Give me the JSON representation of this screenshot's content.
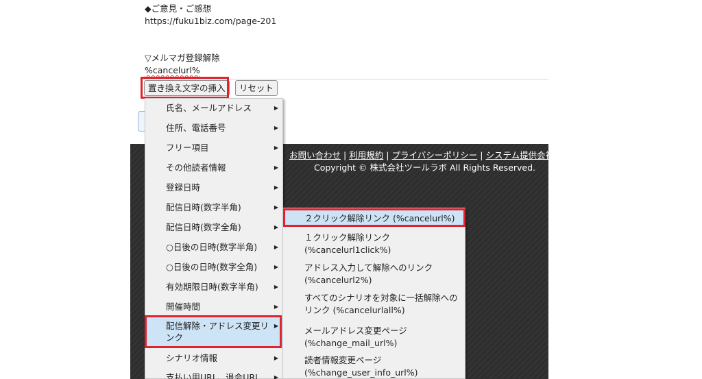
{
  "editor": {
    "line1": "◆ご意見・ご感想",
    "line2": "https://fuku1biz.com/page-201",
    "line3": "▽メルマガ登録解除",
    "line4": "%cancelurl%"
  },
  "buttons": {
    "insert_label": "置き換え文字の挿入",
    "reset_label": "リセット"
  },
  "footer": {
    "links": [
      "お問い合わせ",
      "利用規約",
      "プライバシーポリシー",
      "システム提供会社"
    ],
    "separator": "|",
    "copyright": "Copyright © 株式会社ツールラボ All Rights Reserved."
  },
  "menu1": {
    "items": [
      {
        "label": "氏名、メールアドレス"
      },
      {
        "label": "住所、電話番号"
      },
      {
        "label": "フリー項目"
      },
      {
        "label": "その他読者情報"
      },
      {
        "label": "登録日時"
      },
      {
        "label": "配信日時(数字半角)"
      },
      {
        "label": "配信日時(数字全角)"
      },
      {
        "label": "○日後の日時(数字半角)"
      },
      {
        "label": "○日後の日時(数字全角)"
      },
      {
        "label": "有効期限日時(数字半角)"
      },
      {
        "label": "開催時間"
      },
      {
        "label": "配信解除・アドレス変更リンク"
      },
      {
        "label": "シナリオ情報"
      },
      {
        "label": "支払い用URL、退会URL"
      }
    ],
    "active_index": 11
  },
  "menu2": {
    "items": [
      {
        "line1": "２クリック解除リンク (%cancelurl%)",
        "line2": ""
      },
      {
        "line1": "１クリック解除リンク",
        "line2": "(%cancelurl1click%)"
      },
      {
        "line1": "アドレス入力して解除へのリンク",
        "line2": "(%cancelurl2%)"
      },
      {
        "line1": "すべてのシナリオを対象に一括解除への",
        "line2": "リンク (%cancelurlall%)"
      },
      {
        "line1": "メールアドレス変更ページ",
        "line2": "(%change_mail_url%)"
      },
      {
        "line1": "読者情報変更ページ",
        "line2": "(%change_user_info_url%)"
      }
    ],
    "active_index": 0
  },
  "icons": {
    "submenu_arrow": "chevron-right-icon"
  },
  "colors": {
    "highlight_box": "#e0232f",
    "menu_hover": "#cde3f6",
    "footer_bg": "#2e2e2e"
  }
}
